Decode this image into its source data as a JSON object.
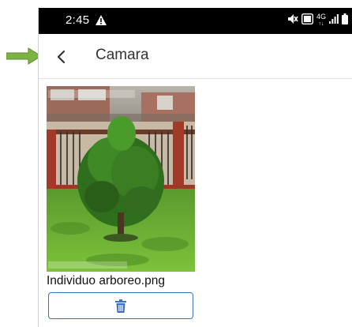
{
  "status_bar": {
    "time": "2:45",
    "network_label": "4G",
    "icons": [
      "warning-icon",
      "mute-icon",
      "data-saver-icon",
      "network-4g-icon",
      "signal-icon",
      "battery-icon"
    ]
  },
  "app_bar": {
    "title": "Camara",
    "back_icon": "chevron-left-icon"
  },
  "attachment": {
    "file_name": "Individuo arboreo.png",
    "delete_icon": "trash-icon"
  },
  "colors": {
    "status_bar": "#000000",
    "accent": "#3f6fc1",
    "annotation_arrow": "#7cb342"
  }
}
